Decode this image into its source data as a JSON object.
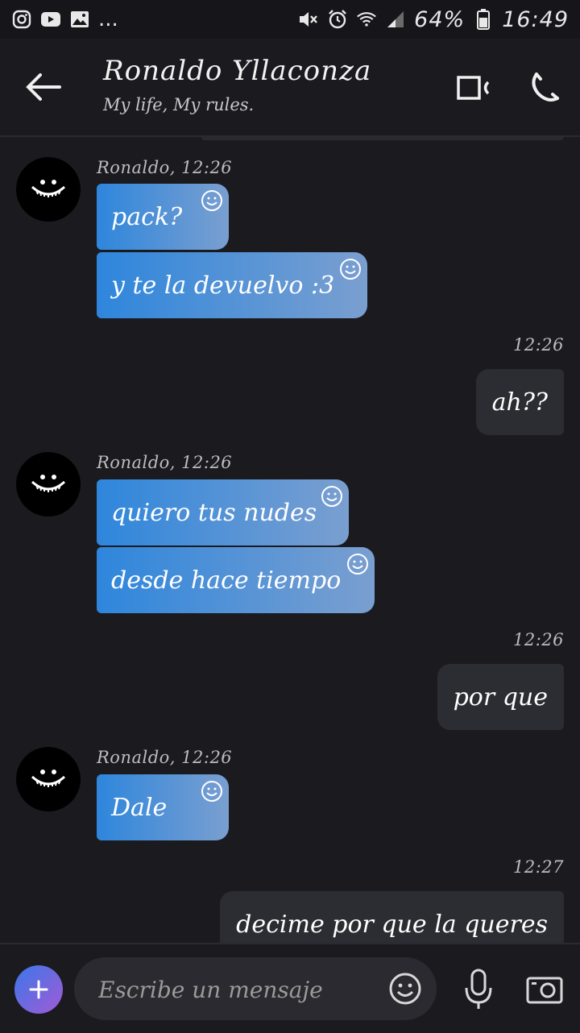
{
  "status_bar": {
    "app_icons": [
      "instagram-icon",
      "youtube-icon",
      "gallery-icon"
    ],
    "more": "...",
    "battery": "64%",
    "time": "16:49"
  },
  "header": {
    "name": "Ronaldo Yllaconza",
    "status": "My life, My rules."
  },
  "messages": [
    {
      "dir": "in",
      "meta": "Ronaldo, 12:26",
      "bubbles": [
        "pack?",
        "y te la devuelvo :3"
      ]
    },
    {
      "dir": "out",
      "meta": "12:26",
      "text": "ah??"
    },
    {
      "dir": "in",
      "meta": "Ronaldo, 12:26",
      "bubbles": [
        "quiero tus nudes",
        "desde hace tiempo"
      ]
    },
    {
      "dir": "out",
      "meta": "12:26",
      "text": "por que"
    },
    {
      "dir": "in",
      "meta": "Ronaldo, 12:26",
      "bubbles": [
        "Dale"
      ]
    },
    {
      "dir": "out",
      "meta": "12:27",
      "text": "decime por que la queres"
    }
  ],
  "composer": {
    "placeholder": "Escribe un mensaje"
  },
  "colors": {
    "background": "#1b1b1f",
    "incoming_start": "#2e86dc",
    "incoming_end": "#7a9fd0",
    "outgoing": "#2c2c33"
  }
}
